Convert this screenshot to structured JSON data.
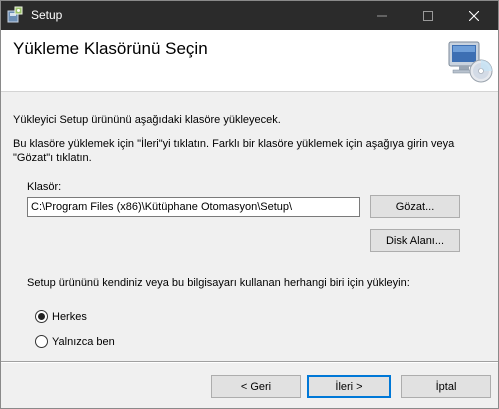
{
  "window": {
    "title": "Setup",
    "controls": {
      "minimize_icon": "minimize-icon",
      "maximize_icon": "maximize-icon",
      "close_icon": "close-icon"
    }
  },
  "header": {
    "title": "Yükleme Klasörünü Seçin",
    "icon": "computer-cd-icon"
  },
  "body": {
    "description1": "Yükleyici Setup ürününü aşağıdaki klasöre yükleyecek.",
    "description2": "Bu klasöre yüklemek için \"İleri\"yi tıklatın. Farklı bir klasöre yüklemek için aşağıya girin veya \"Gözat\"ı tıklatın.",
    "folder_label": "Klasör:",
    "folder_value": "C:\\Program Files (x86)\\Kütüphane Otomasyon\\Setup\\",
    "browse_label": "Gözat...",
    "disk_space_label": "Disk Alanı...",
    "install_for_label": "Setup ürününü kendiniz veya bu bilgisayarı kullanan herhangi biri için yükleyin:",
    "radio_options": [
      {
        "label": "Herkes",
        "checked": true
      },
      {
        "label": "Yalnızca ben",
        "checked": false
      }
    ]
  },
  "footer": {
    "back_label": "< Geri",
    "next_label": "İleri >",
    "cancel_label": "İptal"
  },
  "colors": {
    "titlebar": "#2b2b2b",
    "accent": "#0078d7"
  }
}
